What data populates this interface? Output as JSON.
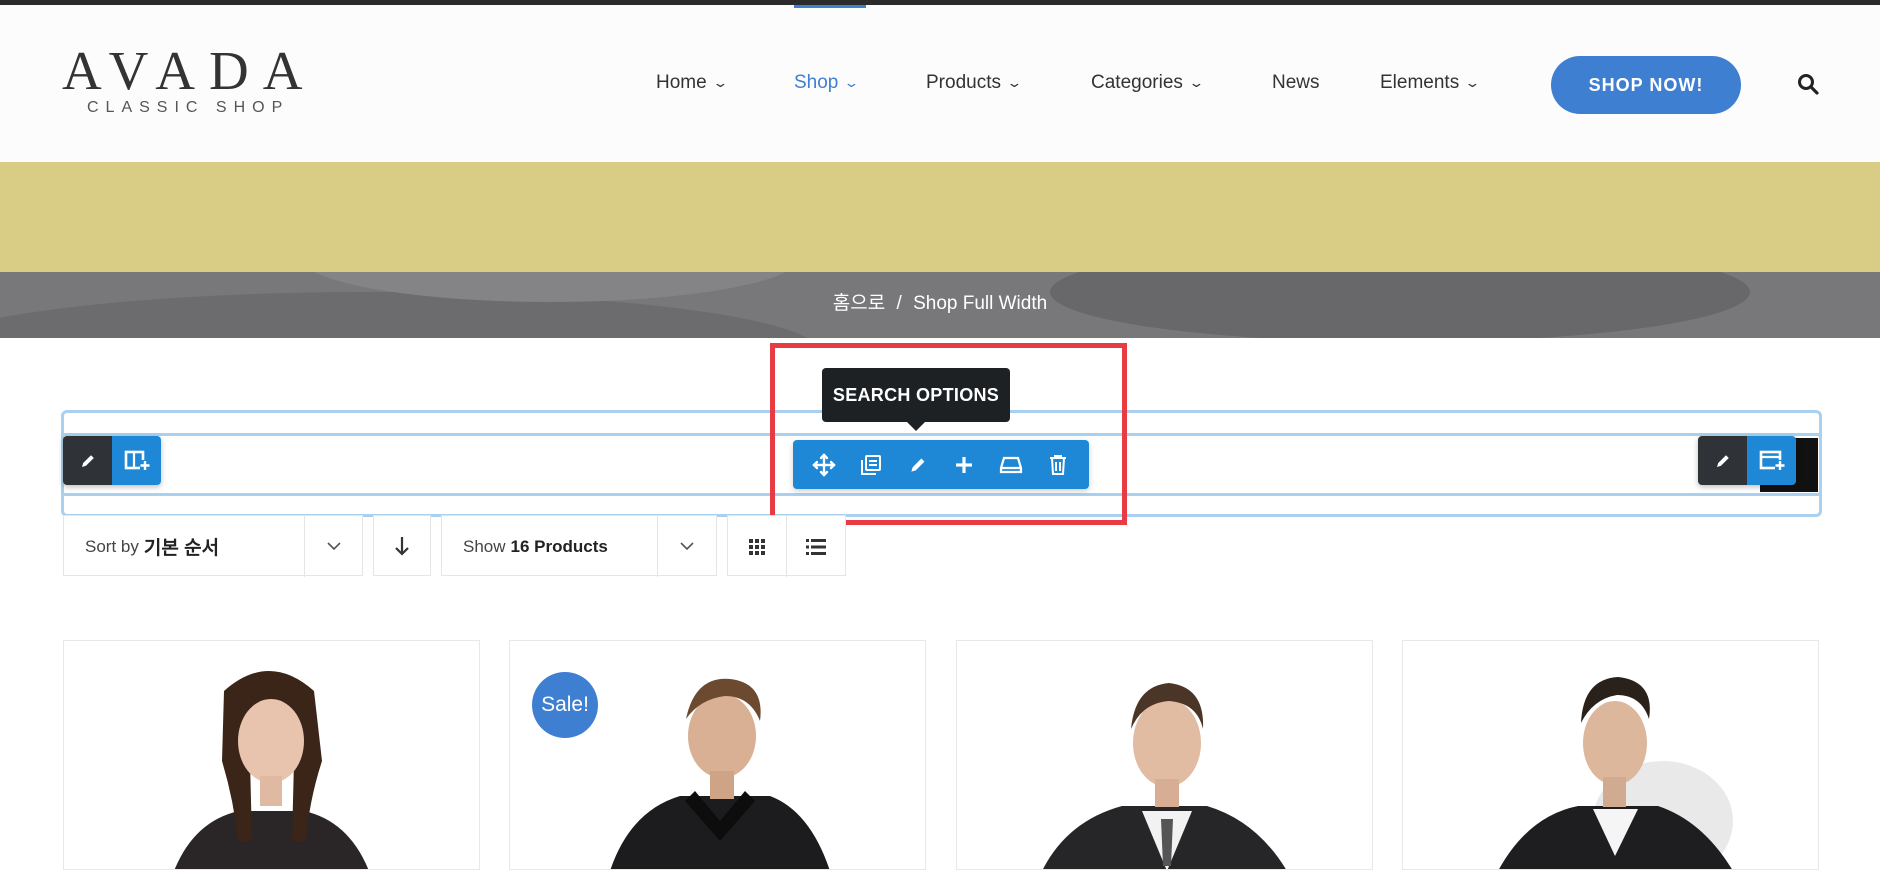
{
  "header": {
    "logo_main": "AVADA",
    "logo_sub": "CLASSIC SHOP",
    "nav": [
      {
        "label": "Home",
        "has_dropdown": true,
        "active": false
      },
      {
        "label": "Shop",
        "has_dropdown": true,
        "active": true
      },
      {
        "label": "Products",
        "has_dropdown": true,
        "active": false
      },
      {
        "label": "Categories",
        "has_dropdown": true,
        "active": false
      },
      {
        "label": "News",
        "has_dropdown": false,
        "active": false
      },
      {
        "label": "Elements",
        "has_dropdown": true,
        "active": false
      }
    ],
    "cta_label": "SHOP NOW!",
    "search_icon": "search-icon"
  },
  "breadcrumb": {
    "home": "홈으로",
    "separator": "/",
    "current": "Shop Full Width"
  },
  "builder": {
    "tooltip": "SEARCH OPTIONS",
    "left_tools": [
      "pencil-icon",
      "add-container-icon"
    ],
    "center_tools": [
      "move-icon",
      "clone-icon",
      "pencil-icon",
      "plus-icon",
      "save-icon",
      "trash-icon"
    ],
    "right_tools": [
      "pencil-icon",
      "add-container-icon"
    ]
  },
  "toolbar": {
    "sort_prefix": "Sort by",
    "sort_value": "기본 순서",
    "show_prefix": "Show",
    "show_value": "16 Products"
  },
  "products": [
    {
      "sale": false,
      "image": "woman-leather-jacket"
    },
    {
      "sale": true,
      "sale_label": "Sale!",
      "image": "man-black-leather-jacket"
    },
    {
      "sale": false,
      "image": "man-jacket-tie"
    },
    {
      "sale": false,
      "image": "man-leather-jacket-white-shirt"
    }
  ],
  "colors": {
    "accent": "#3f7fd1",
    "banner": "#d9cd86",
    "breadcrumb_bar": "#78787a",
    "builder_blue": "#1f88d6",
    "highlight_red": "#e83c44"
  }
}
